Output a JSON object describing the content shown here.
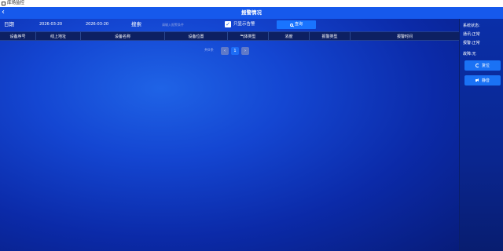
{
  "window": {
    "title": "库场监控"
  },
  "header": {
    "back_glyph": "‹",
    "title": "报警情况"
  },
  "filters": {
    "date_label": "日期",
    "date_start": "2026-03-20",
    "date_end": "2026-03-20",
    "search_label": "搜索",
    "search_placeholder": "请输入报警条件",
    "search_value": "",
    "only_alarm_checked": true,
    "only_alarm_label": "只显示告警",
    "query_button": "查询"
  },
  "table": {
    "columns": [
      "设备序号",
      "线上地址",
      "设备名称",
      "设备位置",
      "气体类型",
      "浓度",
      "报警类型",
      "报警时间"
    ],
    "rows": []
  },
  "pagination": {
    "total_text": "共0条",
    "prev": "‹",
    "current_page": "1",
    "next": "›"
  },
  "sidebar": {
    "status_title": "系统状态:",
    "comm_status": "通讯:正常",
    "alarm_status": "报警:正常",
    "fault_status": "故障:无",
    "reset_button": "复位",
    "mute_button": "静音"
  },
  "colors": {
    "header_blue": "#1659ec",
    "button_blue": "#1a72f5",
    "table_header_bg": "#0d2062",
    "background": "#0c2a8e"
  }
}
